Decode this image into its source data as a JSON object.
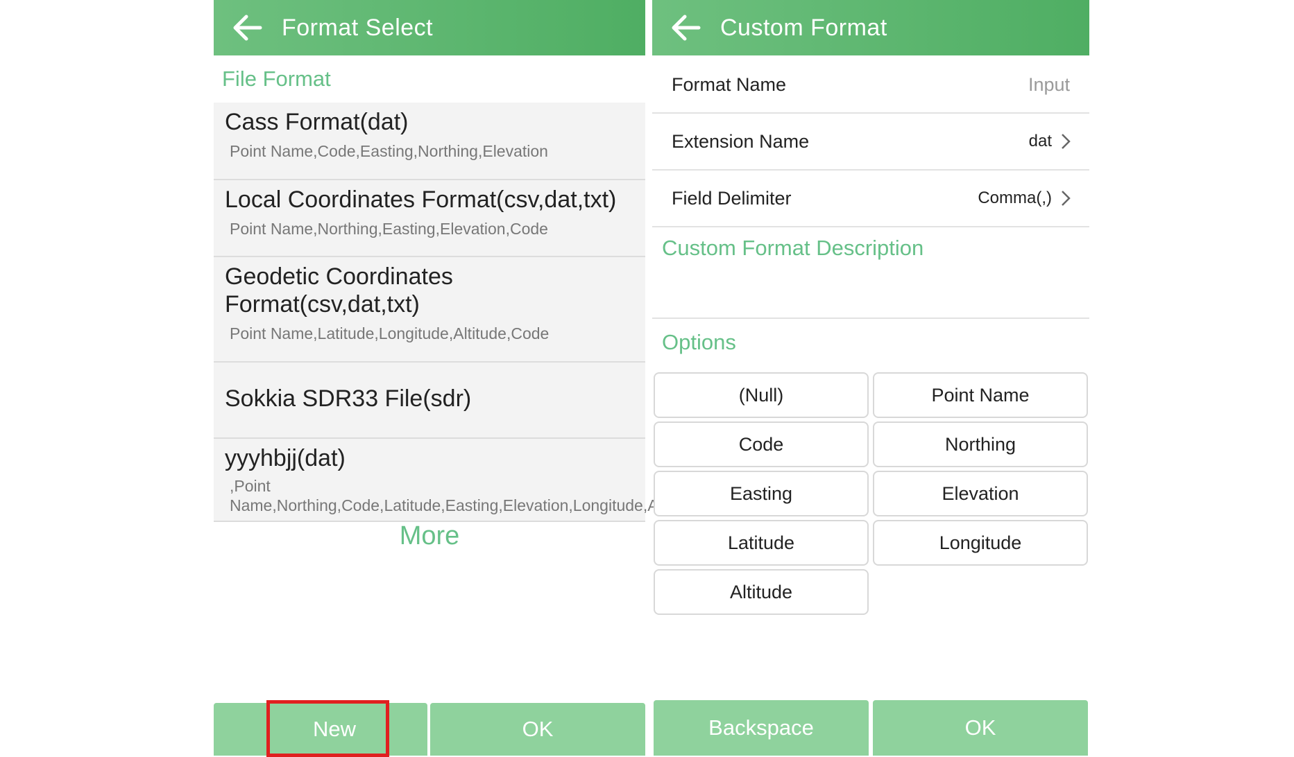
{
  "left_panel": {
    "title": "Format Select",
    "section_label": "File Format",
    "formats": [
      {
        "name": "Cass Format(dat)",
        "desc": "Point Name,Code,Easting,Northing,Elevation"
      },
      {
        "name": "Local Coordinates Format(csv,dat,txt)",
        "desc": "Point Name,Northing,Easting,Elevation,Code"
      },
      {
        "name": "Geodetic Coordinates Format(csv,dat,txt)",
        "desc": "Point Name,Latitude,Longitude,Altitude,Code"
      },
      {
        "name": "Sokkia SDR33 File(sdr)",
        "desc": ""
      },
      {
        "name": "yyyhbjj(dat)",
        "desc": ",Point Name,Northing,Code,Latitude,Easting,Elevation,Longitude,Altitude"
      }
    ],
    "more_label": "More",
    "new_label": "New",
    "ok_label": "OK"
  },
  "right_panel": {
    "title": "Custom Format",
    "format_name_label": "Format Name",
    "format_name_placeholder": "Input",
    "extension_label": "Extension Name",
    "extension_value": "dat",
    "delimiter_label": "Field Delimiter",
    "delimiter_value": "Comma(,)",
    "description_label": "Custom Format Description",
    "options_label": "Options",
    "options": [
      "(Null)",
      "Point Name",
      "Code",
      "Northing",
      "Easting",
      "Elevation",
      "Latitude",
      "Longitude",
      "Altitude"
    ],
    "backspace_label": "Backspace",
    "ok_label": "OK"
  },
  "colors": {
    "header_start": "#6ec07f",
    "header_end": "#4fae63",
    "accent_text": "#66c088",
    "button_bg": "#8fd29d",
    "highlight_border": "#e02020"
  },
  "icons": {
    "back": "arrow-left-icon",
    "chevron": "chevron-right-icon"
  }
}
